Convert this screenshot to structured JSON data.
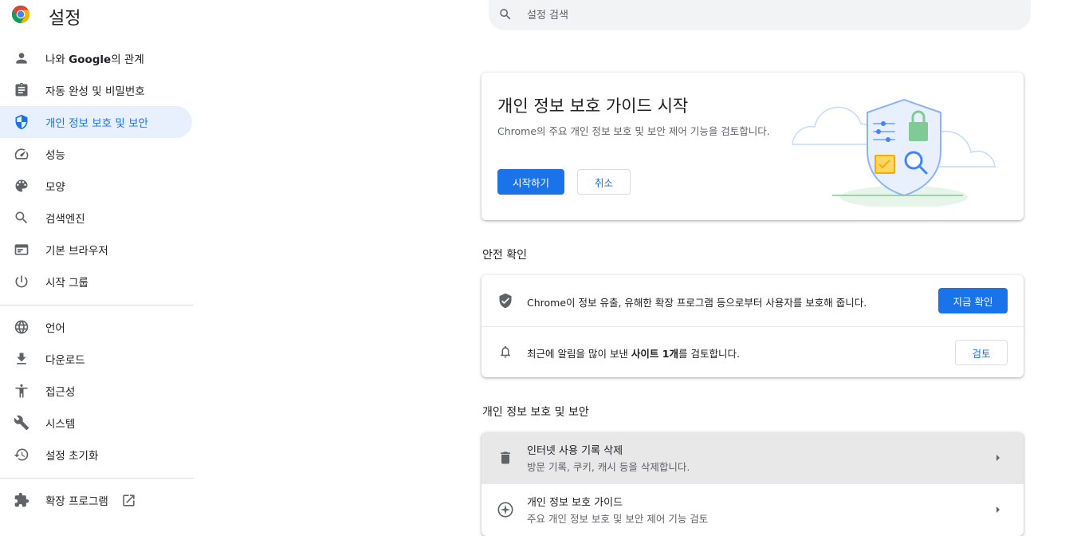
{
  "header": {
    "title": "설정",
    "search_placeholder": "설정 검색"
  },
  "sidebar": {
    "items": [
      {
        "label_pre": "나와 ",
        "label_bold": "Google",
        "label_post": "의 관계",
        "icon": "person-icon"
      },
      {
        "label": "자동 완성 및 비밀번호",
        "icon": "clipboard-icon"
      },
      {
        "label": "개인 정보 보호 및 보안",
        "icon": "shield-icon",
        "active": true
      },
      {
        "label": "성능",
        "icon": "speedometer-icon"
      },
      {
        "label": "모양",
        "icon": "palette-icon"
      },
      {
        "label": "검색엔진",
        "icon": "search-icon"
      },
      {
        "label": "기본 브라우저",
        "icon": "browser-icon"
      },
      {
        "label": "시작 그룹",
        "icon": "power-icon"
      },
      {
        "label": "언어",
        "icon": "globe-icon"
      },
      {
        "label": "다운로드",
        "icon": "download-icon"
      },
      {
        "label": "접근성",
        "icon": "accessibility-icon"
      },
      {
        "label": "시스템",
        "icon": "wrench-icon"
      },
      {
        "label": "설정 초기화",
        "icon": "restore-icon"
      },
      {
        "label": "확장 프로그램",
        "icon": "puzzle-icon"
      }
    ]
  },
  "guide_card": {
    "title": "개인 정보 보호 가이드 시작",
    "description": "Chrome의 주요 개인 정보 보호 및 보안 제어 기능을 검토합니다.",
    "start_button": "시작하기",
    "cancel_button": "취소"
  },
  "safety_check": {
    "section_title": "안전 확인",
    "row1_text": "Chrome이 정보 유출, 유해한 확장 프로그램 등으로부터 사용자를 보호해 줍니다.",
    "row1_button": "지금 확인",
    "row2_pre": "최근에 알림을 많이 보낸 ",
    "row2_bold": "사이트 1개",
    "row2_post": "를 검토합니다.",
    "row2_button": "검토"
  },
  "privacy_section": {
    "section_title": "개인 정보 보호 및 보안",
    "rows": [
      {
        "title": "인터넷 사용 기록 삭제",
        "subtitle": "방문 기록, 쿠키, 캐시 등을 삭제합니다."
      },
      {
        "title": "개인 정보 보호 가이드",
        "subtitle": "주요 개인 정보 보호 및 보안 제어 기능 검토"
      }
    ]
  },
  "colors": {
    "accent": "#1a73e8",
    "active_bg": "#e8f0fe",
    "text": "#202124",
    "secondary_text": "#5f6368"
  }
}
